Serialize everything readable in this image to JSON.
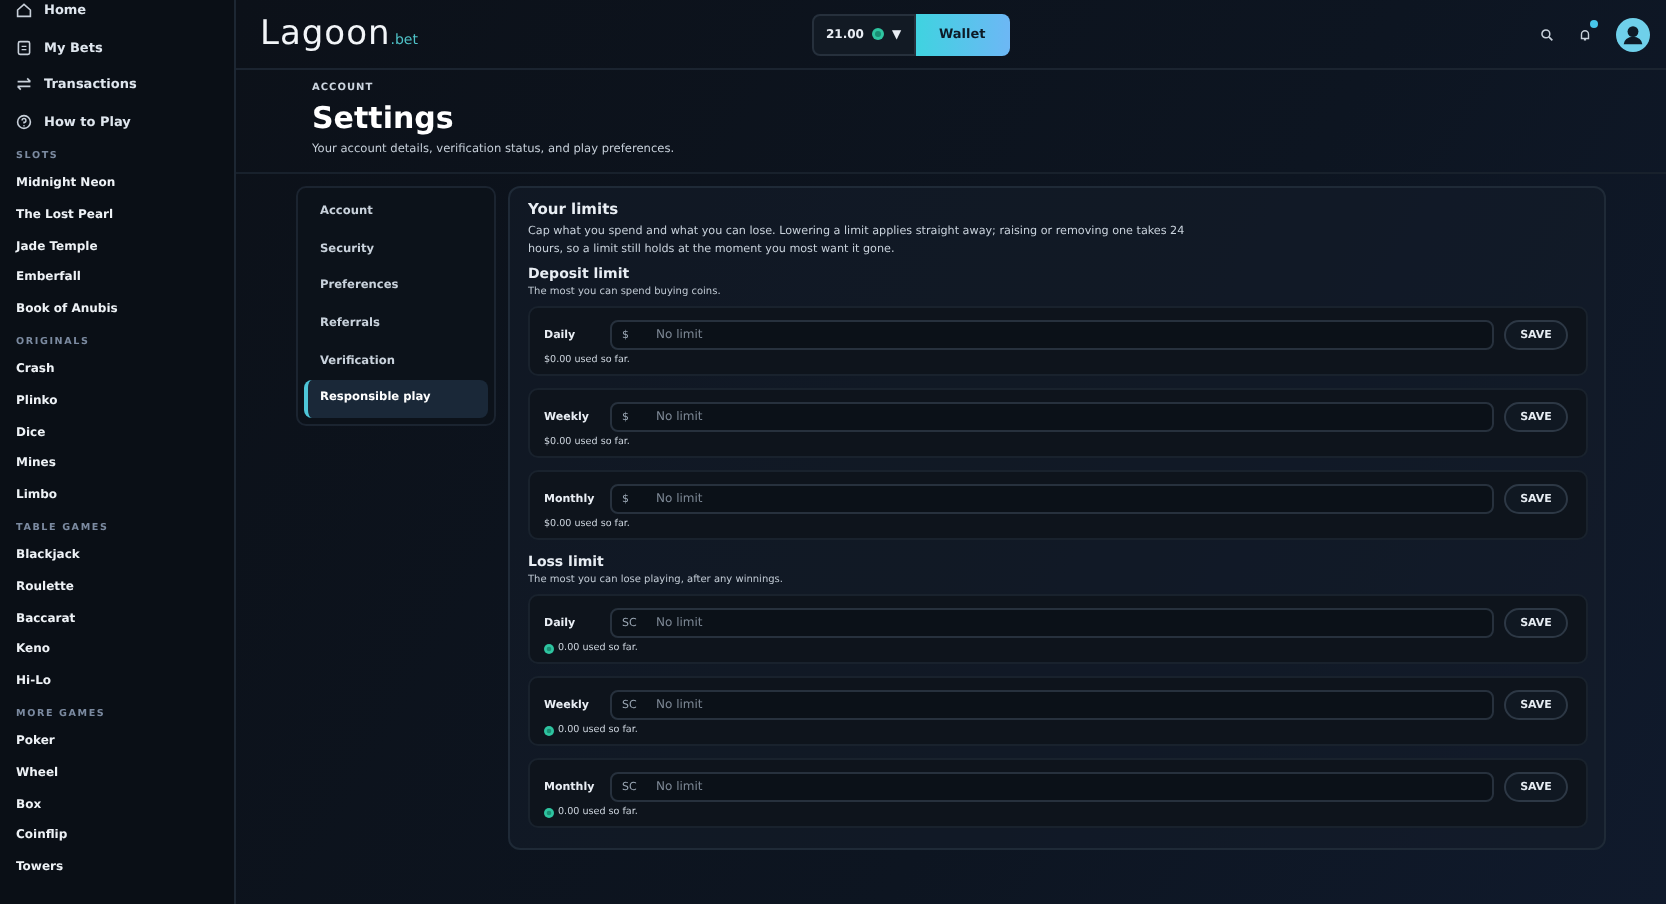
{
  "sidebar": {
    "nav": [
      {
        "label": "Home"
      },
      {
        "label": "My Bets"
      },
      {
        "label": "Transactions"
      },
      {
        "label": "How to Play"
      }
    ],
    "sections": [
      {
        "title": "SLOTS",
        "items": [
          "Midnight Neon",
          "The Lost Pearl",
          "Jade Temple",
          "Emberfall",
          "Book of Anubis"
        ]
      },
      {
        "title": "ORIGINALS",
        "items": [
          "Crash",
          "Plinko",
          "Dice",
          "Mines",
          "Limbo"
        ]
      },
      {
        "title": "TABLE GAMES",
        "items": [
          "Blackjack",
          "Roulette",
          "Baccarat",
          "Keno",
          "Hi-Lo"
        ]
      },
      {
        "title": "MORE GAMES",
        "items": [
          "Poker",
          "Wheel",
          "Box",
          "Coinflip",
          "Towers"
        ]
      }
    ]
  },
  "header": {
    "logo": "Lagoon",
    "logo_suffix": ".bet",
    "balance": "21.00",
    "caret": "▼",
    "wallet": "Wallet",
    "notification_dot": true
  },
  "page": {
    "eyebrow": "ACCOUNT",
    "title": "Settings",
    "subtitle": "Your account details, verification status, and play preferences."
  },
  "settings_nav": [
    {
      "label": "Account",
      "selected": false
    },
    {
      "label": "Security",
      "selected": false
    },
    {
      "label": "Preferences",
      "selected": false
    },
    {
      "label": "Referrals",
      "selected": false
    },
    {
      "label": "Verification",
      "selected": false
    },
    {
      "label": "Responsible play",
      "selected": true
    }
  ],
  "limits": {
    "title": "Your limits",
    "description": "Cap what you spend and what you can lose. Lowering a limit applies straight away; raising or removing one takes 24 hours, so a limit still holds at the moment you most want it gone.",
    "groups": [
      {
        "title": "Deposit limit",
        "subtitle": "The most you can spend buying coins.",
        "coin": false,
        "rows": [
          {
            "period": "Daily",
            "unit": "$",
            "placeholder": "No limit",
            "used": "$0.00 used so far.",
            "button": "SAVE"
          },
          {
            "period": "Weekly",
            "unit": "$",
            "placeholder": "No limit",
            "used": "$0.00 used so far.",
            "button": "SAVE"
          },
          {
            "period": "Monthly",
            "unit": "$",
            "placeholder": "No limit",
            "used": "$0.00 used so far.",
            "button": "SAVE"
          }
        ]
      },
      {
        "title": "Loss limit",
        "subtitle": "The most you can lose playing, after any winnings.",
        "coin": true,
        "rows": [
          {
            "period": "Daily",
            "unit": "SC",
            "placeholder": "No limit",
            "used": "0.00 used so far.",
            "button": "SAVE"
          },
          {
            "period": "Weekly",
            "unit": "SC",
            "placeholder": "No limit",
            "used": "0.00 used so far.",
            "button": "SAVE"
          },
          {
            "period": "Monthly",
            "unit": "SC",
            "placeholder": "No limit",
            "used": "0.00 used so far.",
            "button": "SAVE"
          }
        ]
      }
    ]
  }
}
